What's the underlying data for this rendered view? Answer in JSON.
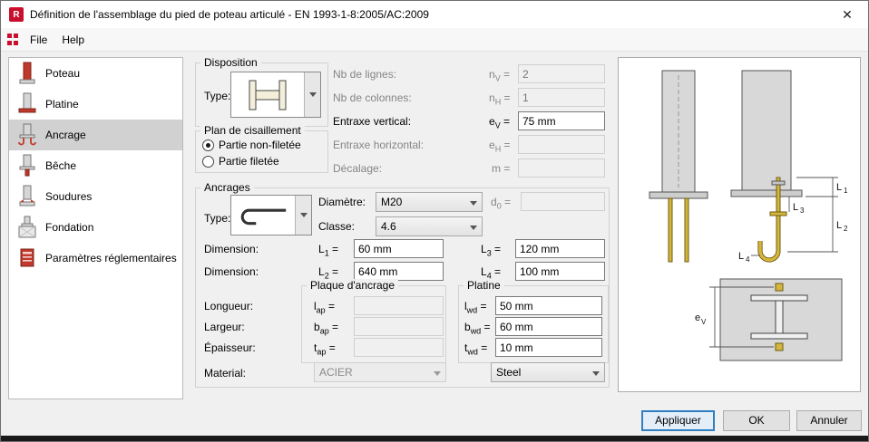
{
  "window": {
    "title": "Définition de l'assemblage du pied de poteau articulé - EN 1993-1-8:2005/AC:2009",
    "app_icon": "R",
    "close_glyph": "✕"
  },
  "menu": {
    "file": "File",
    "help": "Help"
  },
  "sidebar": {
    "items": [
      {
        "label": "Poteau",
        "icon": "column-icon",
        "selected": false
      },
      {
        "label": "Platine",
        "icon": "base-plate-icon",
        "selected": false
      },
      {
        "label": "Ancrage",
        "icon": "anchor-icon",
        "selected": true
      },
      {
        "label": "Bêche",
        "icon": "shear-key-icon",
        "selected": false
      },
      {
        "label": "Soudures",
        "icon": "welds-icon",
        "selected": false
      },
      {
        "label": "Fondation",
        "icon": "foundation-icon",
        "selected": false
      },
      {
        "label": "Paramètres réglementaires",
        "icon": "code-parameters-icon",
        "selected": false
      }
    ]
  },
  "symbols": {
    "eq": "="
  },
  "disposition": {
    "title": "Disposition",
    "type_label": "Type:",
    "rows": [
      {
        "label": "Nb de lignes:",
        "sym": "n",
        "sub": "V",
        "value": "2",
        "disabled": true
      },
      {
        "label": "Nb de colonnes:",
        "sym": "n",
        "sub": "H",
        "value": "1",
        "disabled": true
      },
      {
        "label": "Entraxe vertical:",
        "sym": "e",
        "sub": "V",
        "value": "75 mm",
        "disabled": false
      },
      {
        "label": "Entraxe horizontal:",
        "sym": "e",
        "sub": "H",
        "value": "",
        "disabled": true
      },
      {
        "label": "Décalage:",
        "sym": "m",
        "sub": "",
        "value": "",
        "disabled": true
      }
    ]
  },
  "shear_plane": {
    "title": "Plan de cisaillement",
    "option1": "Partie non-filetée",
    "option2": "Partie filetée",
    "selected": "Partie non-filetée"
  },
  "anchors": {
    "title": "Ancrages",
    "type_label": "Type:",
    "diameter_label": "Diamètre:",
    "diameter_value": "M20",
    "d0_sym": "d",
    "d0_sub": "0",
    "d0_value": "",
    "class_label": "Classe:",
    "class_value": "4.6",
    "dimension_label": "Dimension:",
    "L1_sym": "L",
    "L1_sub": "1",
    "L1_value": "60 mm",
    "L2_sym": "L",
    "L2_sub": "2",
    "L2_value": "640 mm",
    "L3_sym": "L",
    "L3_sub": "3",
    "L3_value": "120 mm",
    "L4_sym": "L",
    "L4_sub": "4",
    "L4_value": "100 mm",
    "anchor_plate": {
      "title": "Plaque d'ancrage",
      "l_sym": "l",
      "l_sub": "ap",
      "l_value": "",
      "b_sym": "b",
      "b_sub": "ap",
      "b_value": "",
      "t_sym": "t",
      "t_sub": "ap",
      "t_value": "",
      "material": "ACIER"
    },
    "plate": {
      "title": "Platine",
      "l_sym": "l",
      "l_sub": "wd",
      "l_value": "50 mm",
      "b_sym": "b",
      "b_sub": "wd",
      "b_value": "60 mm",
      "t_sym": "t",
      "t_sub": "wd",
      "t_value": "10 mm",
      "material": "Steel"
    },
    "length_label": "Longueur:",
    "width_label": "Largeur:",
    "thickness_label": "Épaisseur:",
    "material_label": "Material:"
  },
  "diagram": {
    "l1_sym": "L",
    "l1_sub": "1",
    "l2_sym": "L",
    "l2_sub": "2",
    "l3_sym": "L",
    "l3_sub": "3",
    "l4_sym": "L",
    "l4_sub": "4",
    "ev_sym": "e",
    "ev_sub": "V"
  },
  "buttons": {
    "apply": "Appliquer",
    "ok": "OK",
    "cancel": "Annuler"
  },
  "colors": {
    "accent": "#2f7fc1",
    "anchor_yellow": "#d4b63c",
    "icon_red": "#c0392b"
  }
}
